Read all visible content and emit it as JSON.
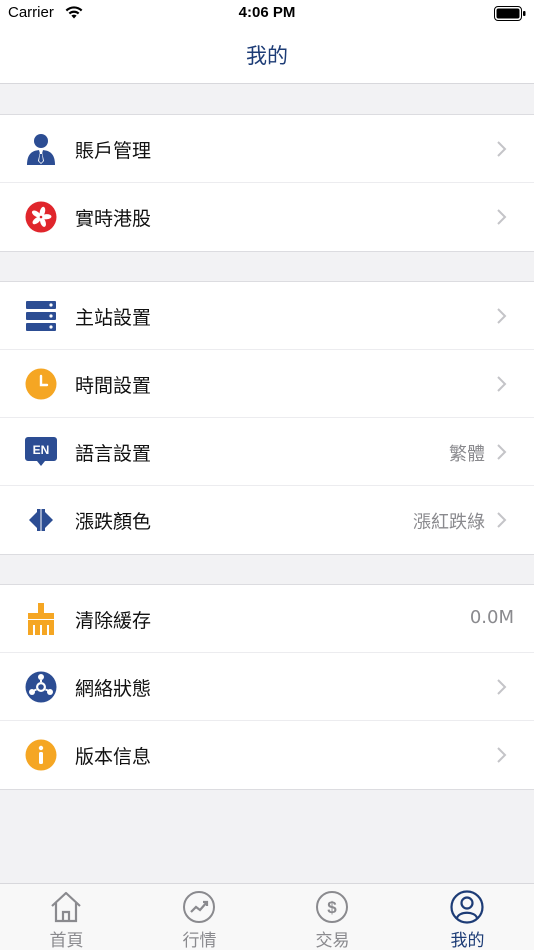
{
  "status_bar": {
    "carrier": "Carrier",
    "time": "4:06 PM"
  },
  "nav": {
    "title": "我的"
  },
  "colors": {
    "brand_blue": "#1d3c76",
    "icon_blue": "#2c4d93",
    "icon_orange": "#f5a623",
    "icon_red": "#e0262c",
    "muted_gray": "#8a8a8e"
  },
  "groups": [
    {
      "rows": [
        {
          "label": "賬戶管理",
          "icon": "user-tie-icon",
          "value": ""
        },
        {
          "label": "實時港股",
          "icon": "hk-flag-icon",
          "value": ""
        }
      ]
    },
    {
      "rows": [
        {
          "label": "主站設置",
          "icon": "server-icon",
          "value": ""
        },
        {
          "label": "時間設置",
          "icon": "clock-icon",
          "value": ""
        },
        {
          "label": "語言設置",
          "icon": "language-en-icon",
          "value": "繁體"
        },
        {
          "label": "漲跌顏色",
          "icon": "up-down-arrows-icon",
          "value": "漲紅跌綠"
        }
      ]
    },
    {
      "rows": [
        {
          "label": "清除緩存",
          "icon": "broom-icon",
          "value": "0.0M"
        },
        {
          "label": "網絡狀態",
          "icon": "network-icon",
          "value": ""
        },
        {
          "label": "版本信息",
          "icon": "info-icon",
          "value": ""
        }
      ]
    }
  ],
  "tabs": [
    {
      "label": "首頁",
      "icon": "home-icon",
      "active": false
    },
    {
      "label": "行情",
      "icon": "market-trend-icon",
      "active": false
    },
    {
      "label": "交易",
      "icon": "dollar-icon",
      "active": false
    },
    {
      "label": "我的",
      "icon": "profile-icon",
      "active": true
    }
  ]
}
